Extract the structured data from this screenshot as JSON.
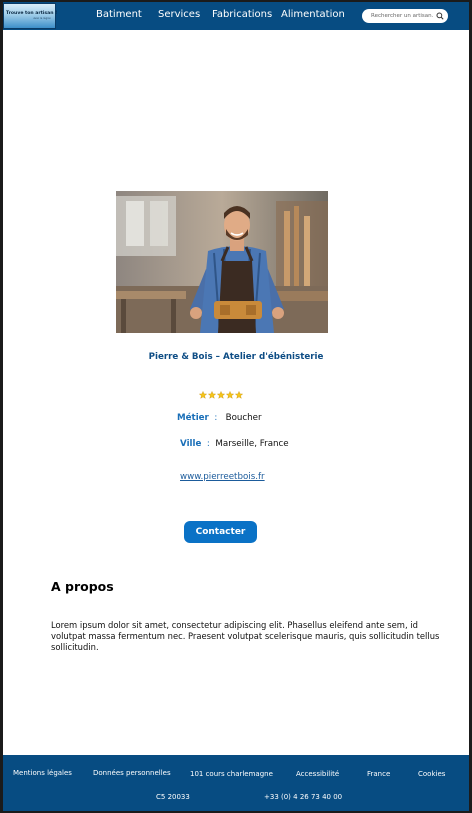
{
  "header": {
    "logo_title": "Trouve ton artisan !",
    "logo_subtitle": "Avec la région",
    "nav": [
      "Batiment",
      "Services",
      "Fabrications",
      "Alimentation"
    ],
    "search_placeholder": "Rechercher un artisan..."
  },
  "artisan": {
    "name": "Pierre & Bois – Atelier d'ébénisterie",
    "rating": 5,
    "metier_label": "Métier",
    "metier_value": "Boucher",
    "ville_label": "Ville",
    "ville_value": "Marseille, France",
    "website": "www.pierreetbois.fr",
    "contact_label": "Contacter"
  },
  "about": {
    "title": "A propos",
    "text": "Lorem ipsum dolor sit amet, consectetur adipiscing elit. Phasellus eleifend ante sem, id volutpat massa fermentum nec. Praesent volutpat scelerisque mauris, quis sollicitudin tellus sollicitudin."
  },
  "footer": {
    "mentions": "Mentions légales",
    "donnees": "Données personnelles",
    "address": "101 cours charlemagne",
    "accessibilite": "Accessibilité",
    "country": "France",
    "cookies": "Cookies",
    "postal": "C5 20033",
    "phone": "+33 (0) 4 26 73 40 00"
  },
  "colors": {
    "header_bg": "#074c82",
    "accent": "#0a72c6",
    "star": "#f5c518"
  }
}
